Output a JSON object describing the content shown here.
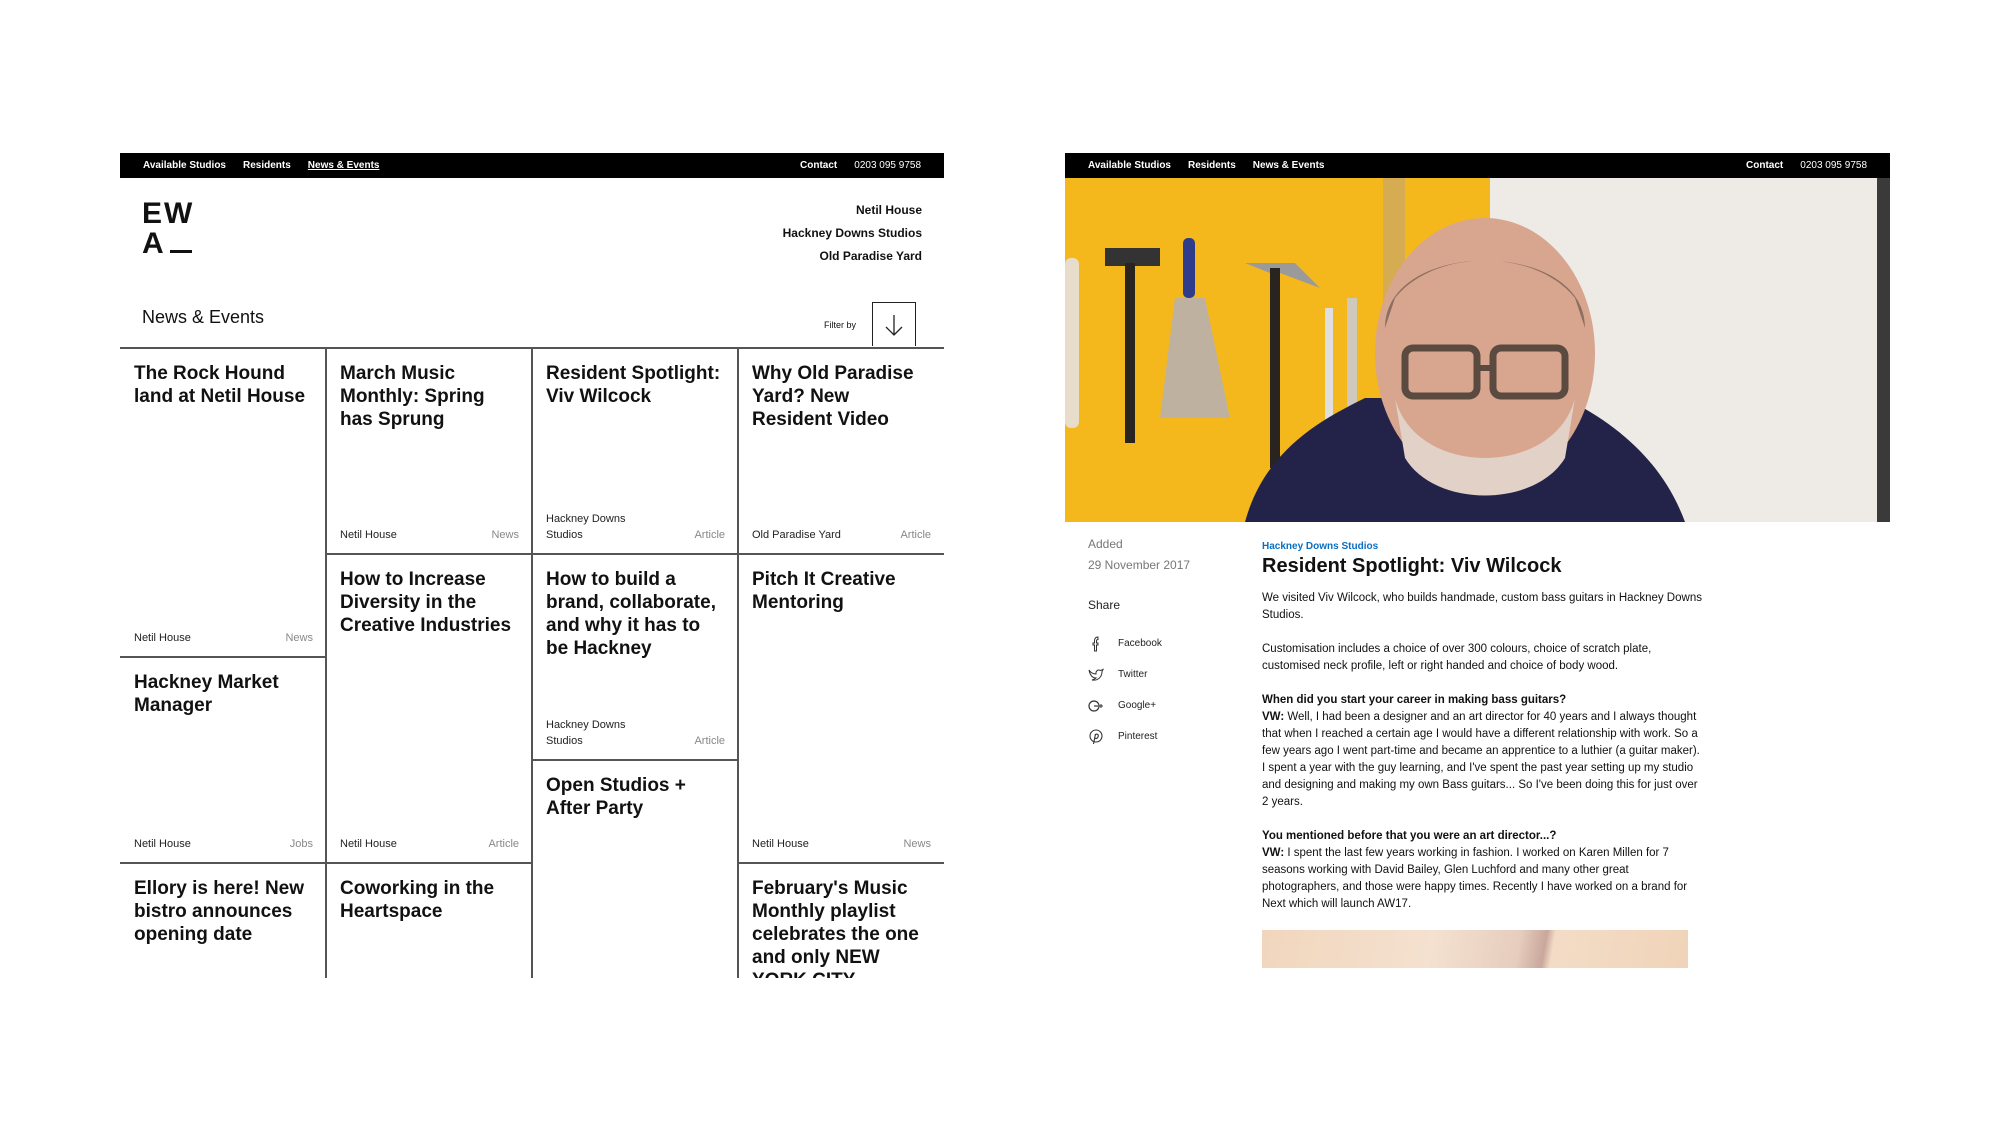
{
  "nav": {
    "items": [
      "Available Studios",
      "Residents",
      "News & Events"
    ],
    "active_index": 2,
    "contact": "Contact",
    "phone": "0203 095 9758"
  },
  "logo": {
    "line1": "EW",
    "line2": "A"
  },
  "locations": [
    "Netil House",
    "Hackney Downs Studios",
    "Old Paradise Yard"
  ],
  "listing": {
    "title": "News & Events",
    "filter_label": "Filter by",
    "cards": [
      {
        "title": "The Rock Hound land at Netil House",
        "location": "Netil House",
        "type": "News"
      },
      {
        "title": "Hackney Market Manager",
        "location": "Netil House",
        "type": "Jobs"
      },
      {
        "title": "Ellory is here! New bistro announces opening date",
        "location": "",
        "type": ""
      },
      {
        "title": "March Music Monthly: Spring has Sprung",
        "location": "Netil House",
        "type": "News"
      },
      {
        "title": "How to Increase Diversity in the Creative Industries",
        "location": "Netil House",
        "type": "Article"
      },
      {
        "title": "Coworking in the Heartspace",
        "location": "",
        "type": ""
      },
      {
        "title": "Resident Spotlight: Viv Wilcock",
        "location": "Hackney Downs Studios",
        "type": "Article"
      },
      {
        "title": "How to build a brand, collaborate, and why it has to be Hackney",
        "location": "Hackney Downs Studios",
        "type": "Article"
      },
      {
        "title": "Open Studios + After Party",
        "location": "",
        "type": ""
      },
      {
        "title": "Why Old Paradise Yard? New Resident Video",
        "location": "Old Paradise Yard",
        "type": "Article"
      },
      {
        "title": "Pitch It Creative Mentoring",
        "location": "Netil House",
        "type": "News"
      },
      {
        "title": "February's Music Monthly playlist celebrates the one and only NEW YORK CITY",
        "location": "",
        "type": ""
      }
    ]
  },
  "article": {
    "added_label": "Added",
    "date": "29 November 2017",
    "share_label": "Share",
    "share": [
      {
        "icon": "facebook-icon",
        "label": "Facebook"
      },
      {
        "icon": "twitter-icon",
        "label": "Twitter"
      },
      {
        "icon": "google-plus-icon",
        "label": "Google+"
      },
      {
        "icon": "pinterest-icon",
        "label": "Pinterest"
      }
    ],
    "category": "Hackney Downs Studios",
    "category_color": "#0a6fc2",
    "title": "Resident Spotlight: Viv Wilcock",
    "p1": "We visited Viv Wilcock, who builds handmade, custom bass guitars in Hackney Downs Studios.",
    "p2": "Customisation includes a choice of over 300 colours, choice of scratch plate, customised neck profile, left or right handed and choice of body wood.",
    "q1": "When did you start your career in making bass guitars?",
    "a1_label": "VW:",
    "a1": " Well, I had been a designer and an art director for 40 years and I always thought that when I reached a certain age I would have a different relationship with work. So a few years ago I went part-time and became an apprentice to a luthier (a guitar maker). I spent a year with the guy learning, and I've spent the past year setting up my studio and designing and making my own Bass guitars... So I've been doing this for just over 2 years.",
    "q2": "You mentioned before that you were an art director...?",
    "a2_label": "VW:",
    "a2": " I spent the last few years working in fashion. I worked on Karen Millen for 7 seasons working with David Bailey, Glen Luchford and many other great photographers, and those were happy times. Recently I have worked on a brand for Next which will launch AW17."
  }
}
